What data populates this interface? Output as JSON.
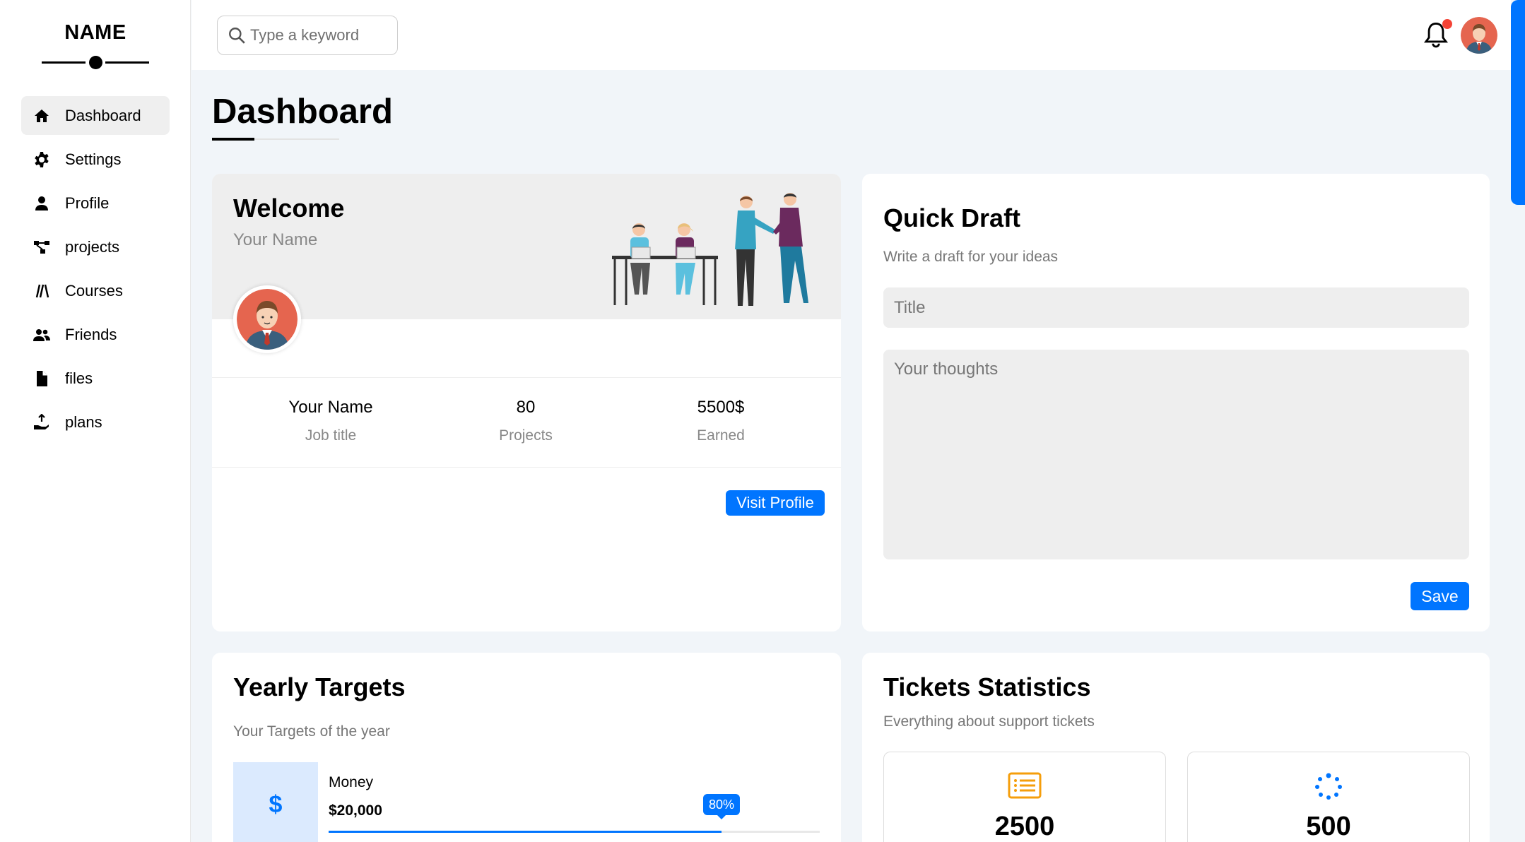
{
  "sidebar": {
    "brand": "NAME",
    "items": [
      {
        "label": "Dashboard",
        "icon": "home-icon",
        "active": true
      },
      {
        "label": "Settings",
        "icon": "gear-icon"
      },
      {
        "label": "Profile",
        "icon": "user-icon"
      },
      {
        "label": "projects",
        "icon": "diagram-icon"
      },
      {
        "label": "Courses",
        "icon": "courses-icon"
      },
      {
        "label": "Friends",
        "icon": "friends-icon"
      },
      {
        "label": "files",
        "icon": "file-icon"
      },
      {
        "label": "plans",
        "icon": "hand-money-icon"
      }
    ]
  },
  "header": {
    "search_placeholder": "Type a keyword",
    "notification_icon": "bell-icon",
    "has_notification": true
  },
  "page": {
    "title": "Dashboard"
  },
  "welcome": {
    "title": "Welcome",
    "subtitle": "Your Name",
    "stats": [
      {
        "value": "Your Name",
        "label": "Job title"
      },
      {
        "value": "80",
        "label": "Projects"
      },
      {
        "value": "5500$",
        "label": "Earned"
      }
    ],
    "button": "Visit Profile"
  },
  "draft": {
    "title": "Quick Draft",
    "subtitle": "Write a draft for your ideas",
    "title_placeholder": "Title",
    "text_placeholder": "Your thoughts",
    "button": "Save"
  },
  "targets": {
    "title": "Yearly Targets",
    "subtitle": "Your Targets of the year",
    "items": [
      {
        "label": "Money",
        "value": "$20,000",
        "progress_label": "80%",
        "progress": 0.8,
        "icon": "dollar-icon",
        "symbol": "$"
      }
    ]
  },
  "tickets": {
    "title": "Tickets Statistics",
    "subtitle": "Everything about support tickets",
    "items": [
      {
        "value": "2500",
        "icon": "list-icon"
      },
      {
        "value": "500",
        "icon": "spinner-icon"
      }
    ]
  },
  "colors": {
    "accent": "#0075ff",
    "ticket_orange": "#f59e0b",
    "notification": "#f44336"
  }
}
